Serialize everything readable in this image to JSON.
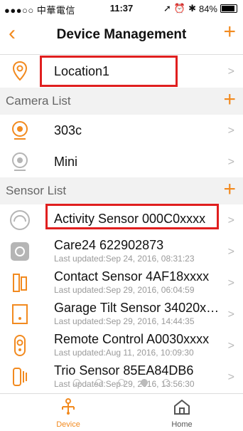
{
  "status": {
    "carrier": "●●●○○ 中華電信",
    "time": "11:37",
    "battery": "84%"
  },
  "nav": {
    "title": "Device Management",
    "back_icon": "chevron-left-icon",
    "add_icon": "plus-icon"
  },
  "location": {
    "name": "Location1"
  },
  "camera_section": {
    "label": "Camera List"
  },
  "cameras": [
    {
      "name": "303c"
    },
    {
      "name": "Mini"
    }
  ],
  "sensor_section": {
    "label": "Sensor List"
  },
  "sensors": [
    {
      "name": "Activity Sensor 000C0xxxx",
      "updated": ""
    },
    {
      "name": "Care24 622902873",
      "updated": "Last updated:Sep 24, 2016, 08:31:23"
    },
    {
      "name": "Contact Sensor 4AF18xxxx",
      "updated": "Last updated:Sep 29, 2016, 06:04:59"
    },
    {
      "name": "Garage Tilt Sensor 34020x…",
      "updated": "Last updated:Sep 29, 2016, 14:44:35"
    },
    {
      "name": "Remote Control A0030xxxx",
      "updated": "Last updated:Aug 11, 2016, 10:09:30"
    },
    {
      "name": "Trio Sensor 85EA84DB6",
      "updated": "Last updated:Sep 29, 2016, 13:56:30"
    }
  ],
  "pager": {
    "pages": 5,
    "active": 4
  },
  "tabs": [
    {
      "label": "Device"
    },
    {
      "label": "Home"
    }
  ],
  "colors": {
    "accent": "#f28a1f",
    "highlight": "#e01f1f"
  }
}
